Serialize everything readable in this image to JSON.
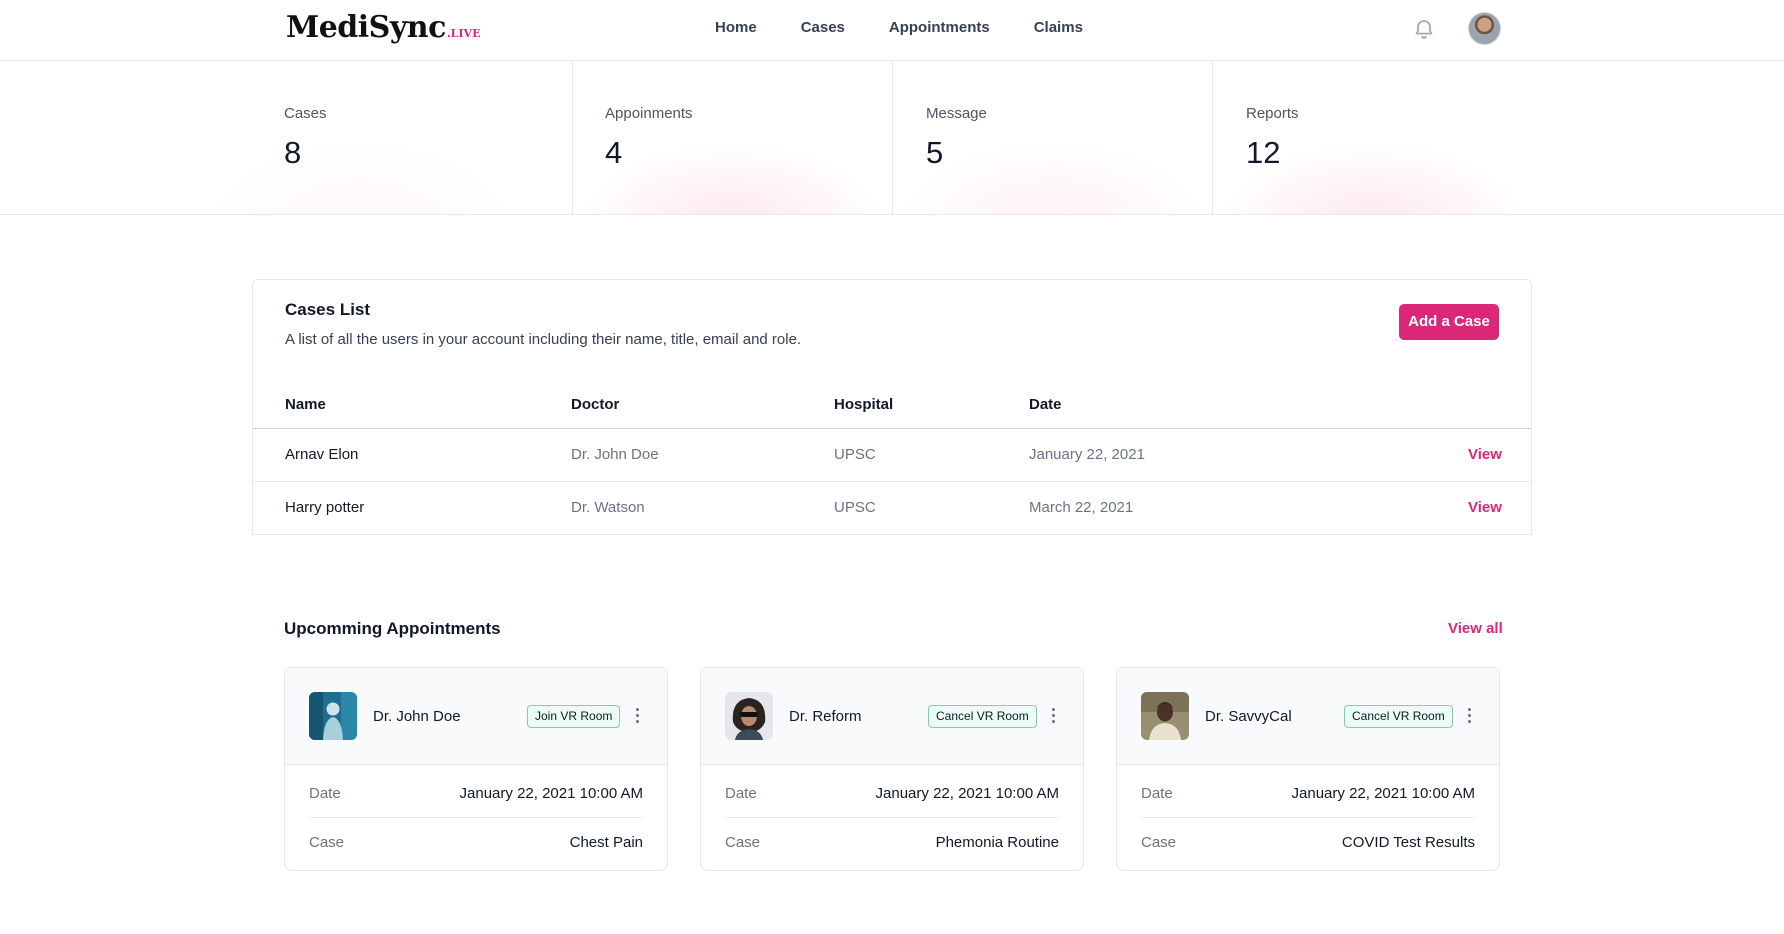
{
  "brand": {
    "name": "MediSync",
    "suffix": ".LIVE",
    "accent": "#db2777"
  },
  "nav": {
    "items": [
      {
        "label": "Home"
      },
      {
        "label": "Cases"
      },
      {
        "label": "Appointments"
      },
      {
        "label": "Claims"
      }
    ]
  },
  "header": {
    "notification_icon": "bell-icon",
    "avatar": "user-avatar"
  },
  "stats": [
    {
      "label": "Cases",
      "value": "8"
    },
    {
      "label": "Appoinments",
      "value": "4"
    },
    {
      "label": "Message",
      "value": "5"
    },
    {
      "label": "Reports",
      "value": "12"
    }
  ],
  "cases": {
    "title": "Cases List",
    "description": "A list of all the users in your account including their name, title, email and role.",
    "add_button": "Add a Case",
    "columns": [
      "Name",
      "Doctor",
      "Hospital",
      "Date"
    ],
    "rows": [
      {
        "name": "Arnav Elon",
        "doctor": "Dr. John Doe",
        "hospital": "UPSC",
        "date": "January 22, 2021",
        "action": "View"
      },
      {
        "name": "Harry potter",
        "doctor": "Dr. Watson",
        "hospital": "UPSC",
        "date": "March 22, 2021",
        "action": "View"
      }
    ]
  },
  "appointments": {
    "title": "Upcomming Appointments",
    "view_all": "View all",
    "date_label": "Date",
    "case_label": "Case",
    "cards": [
      {
        "doctor": "Dr. John Doe",
        "button": "Join VR Room",
        "date": "January 22, 2021 10:00 AM",
        "case": "Chest Pain"
      },
      {
        "doctor": "Dr. Reform",
        "button": "Cancel VR Room",
        "date": "January 22, 2021 10:00 AM",
        "case": "Phemonia Routine"
      },
      {
        "doctor": "Dr. SavvyCal",
        "button": "Cancel VR Room",
        "date": "January 22, 2021 10:00 AM",
        "case": "COVID Test Results"
      }
    ]
  }
}
